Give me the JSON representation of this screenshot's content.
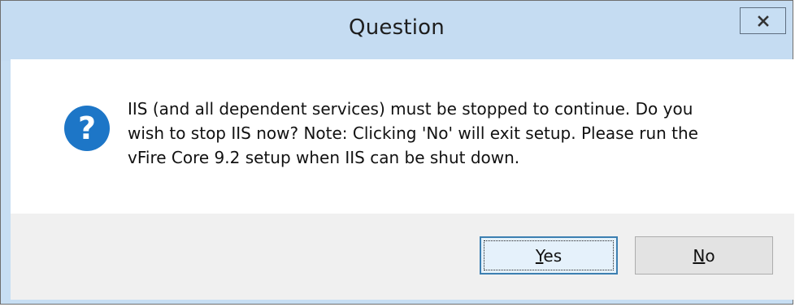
{
  "window": {
    "title": "Question",
    "close_glyph": "x"
  },
  "dialog": {
    "icon": "question-icon",
    "message_lines": [
      "IIS (and all dependent services) must be stopped to continue. Do you",
      "wish to stop IIS now? Note: Clicking 'No' will exit setup. Please run the",
      "vFire Core 9.2 setup when IIS can be shut down."
    ]
  },
  "buttons": {
    "yes": {
      "mnemonic": "Y",
      "rest": "es"
    },
    "no": {
      "mnemonic": "N",
      "rest": "o"
    }
  },
  "colors": {
    "titlebar": "#c5dcf2",
    "icon_blue": "#1d76c7",
    "footer": "#f0f0f0"
  }
}
